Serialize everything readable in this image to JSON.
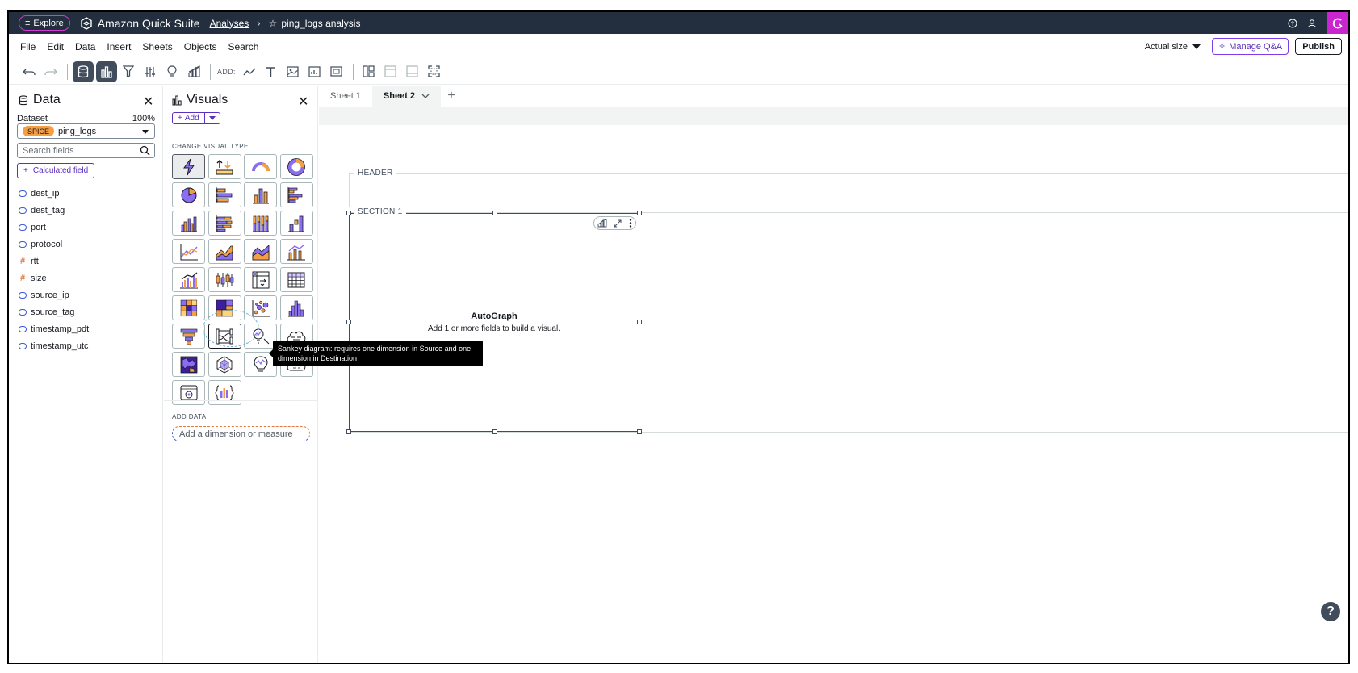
{
  "topbar": {
    "explore_label": "Explore",
    "brand": "Amazon Quick Suite",
    "breadcrumb_analyses": "Analyses",
    "breadcrumb_current": "ping_logs analysis"
  },
  "menu": {
    "items": [
      "File",
      "Edit",
      "Data",
      "Insert",
      "Sheets",
      "Objects",
      "Search"
    ],
    "zoom": "Actual size",
    "manage_qa": "Manage Q&A",
    "publish": "Publish"
  },
  "toolbar": {
    "add_label": "ADD:"
  },
  "data_panel": {
    "title": "Data",
    "dataset_label": "Dataset",
    "dataset_pct": "100%",
    "spice_badge": "SPICE",
    "dataset_name": "ping_logs",
    "search_placeholder": "Search fields",
    "calc_field": "Calculated field",
    "fields": [
      {
        "name": "dest_ip",
        "kind": "dimension"
      },
      {
        "name": "dest_tag",
        "kind": "dimension"
      },
      {
        "name": "port",
        "kind": "dimension"
      },
      {
        "name": "protocol",
        "kind": "dimension"
      },
      {
        "name": "rtt",
        "kind": "measure"
      },
      {
        "name": "size",
        "kind": "measure"
      },
      {
        "name": "source_ip",
        "kind": "dimension"
      },
      {
        "name": "source_tag",
        "kind": "dimension"
      },
      {
        "name": "timestamp_pdt",
        "kind": "dimension"
      },
      {
        "name": "timestamp_utc",
        "kind": "dimension"
      }
    ]
  },
  "visuals_panel": {
    "title": "Visuals",
    "add_label": "Add",
    "change_type_label": "CHANGE VISUAL TYPE",
    "add_data_label": "ADD DATA",
    "add_data_placeholder": "Add a dimension or measure",
    "tooltip": "Sankey diagram: requires one dimension in Source and one dimension in Destination"
  },
  "canvas": {
    "tabs": [
      "Sheet 1",
      "Sheet 2"
    ],
    "active_tab": "Sheet 2",
    "header_label": "HEADER",
    "section_label": "SECTION 1",
    "visual_title": "AutoGraph",
    "visual_hint": "Add 1 or more fields to build a visual."
  },
  "colors": {
    "topbar": "#232f3e",
    "accent_purple": "#5a2fc2",
    "brand_magenta": "#c925d1",
    "spice_orange": "#f59e44",
    "dimension_blue": "#3b5bd7",
    "measure_orange": "#e07941"
  }
}
